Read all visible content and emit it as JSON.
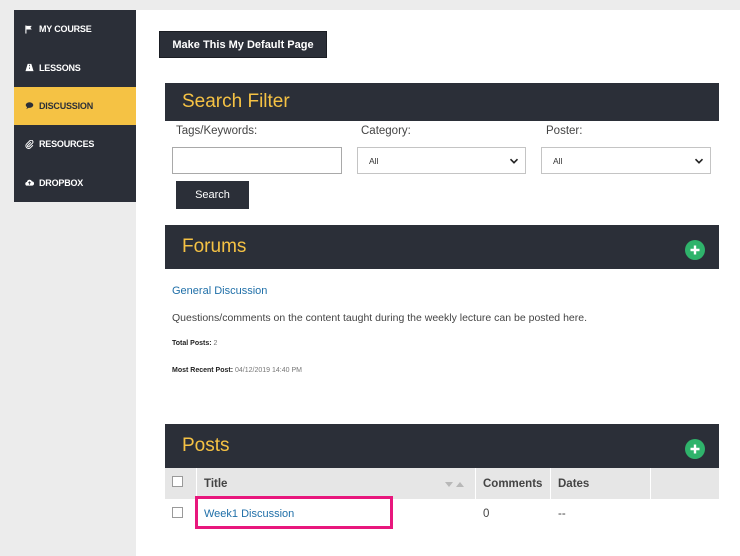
{
  "sidebar": {
    "items": [
      {
        "label": "MY COURSE",
        "icon": "flag-icon",
        "active": false
      },
      {
        "label": "LESSONS",
        "icon": "road-icon",
        "active": false
      },
      {
        "label": "DISCUSSION",
        "icon": "chat-icon",
        "active": true
      },
      {
        "label": "RESOURCES",
        "icon": "paperclip-icon",
        "active": false
      },
      {
        "label": "DROPBOX",
        "icon": "cloud-upload-icon",
        "active": false
      }
    ]
  },
  "default_page_button": "Make This My Default Page",
  "search_filter": {
    "title": "Search Filter",
    "tags_label": "Tags/Keywords:",
    "tags_value": "",
    "category_label": "Category:",
    "category_value": "All",
    "poster_label": "Poster:",
    "poster_value": "All",
    "search_button": "Search"
  },
  "forums": {
    "title": "Forums",
    "forum_name": "General Discussion",
    "forum_description": "Questions/comments on the content taught during the weekly lecture can be posted here.",
    "total_posts_label": "Total Posts:",
    "total_posts_value": "2",
    "recent_post_label": "Most Recent Post:",
    "recent_post_value": "04/12/2019 14:40 PM"
  },
  "posts": {
    "title": "Posts",
    "columns": {
      "title": "Title",
      "comments": "Comments",
      "dates": "Dates"
    },
    "rows": [
      {
        "title": "Week1 Discussion",
        "comments": "0",
        "dates": "--"
      }
    ]
  },
  "colors": {
    "dark": "#2b2f38",
    "accent": "#f5c244",
    "link": "#1f6fa8",
    "add": "#2fb36b",
    "highlight": "#e8177d"
  }
}
